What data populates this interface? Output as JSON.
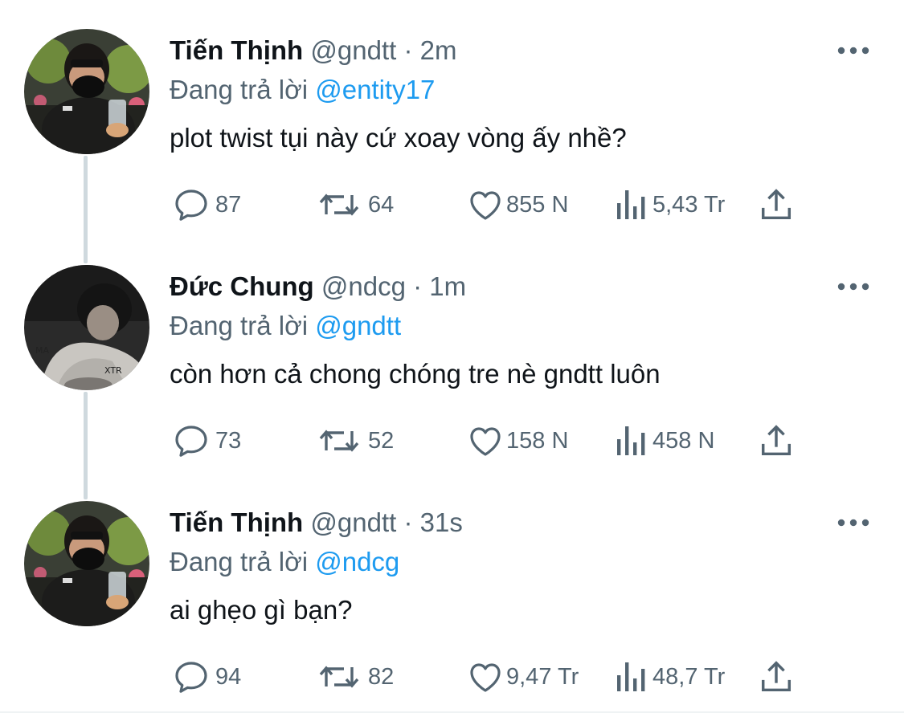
{
  "colors": {
    "text_primary": "#0f1419",
    "text_secondary": "#536471",
    "link": "#1d9bf0",
    "thread_line": "#cfd9de"
  },
  "tweets": [
    {
      "name": "Tiến Thịnh",
      "handle": "@gndtt",
      "separator": "·",
      "time": "2m",
      "reply_prefix": "Đang trả lời",
      "reply_mention": "@entity17",
      "text": "plot twist tụi này cứ xoay vòng ấy nhề?",
      "replies": "87",
      "retweets": "64",
      "likes": "855 N",
      "views": "5,43 Tr",
      "avatar_icon": "avatar-photo-icon"
    },
    {
      "name": "Đức Chung",
      "handle": "@ndcg",
      "separator": "·",
      "time": "1m",
      "reply_prefix": "Đang trả lời",
      "reply_mention": "@gndtt",
      "text": "còn hơn cả chong chóng tre nè gndtt luôn",
      "replies": "73",
      "retweets": "52",
      "likes": "158 N",
      "views": "458 N",
      "avatar_icon": "avatar-photo-icon"
    },
    {
      "name": "Tiến Thịnh",
      "handle": "@gndtt",
      "separator": "·",
      "time": "31s",
      "reply_prefix": "Đang trả lời",
      "reply_mention": "@ndcg",
      "text": "ai ghẹo gì bạn?",
      "replies": "94",
      "retweets": "82",
      "likes": "9,47 Tr",
      "views": "48,7 Tr",
      "avatar_icon": "avatar-photo-icon"
    }
  ]
}
